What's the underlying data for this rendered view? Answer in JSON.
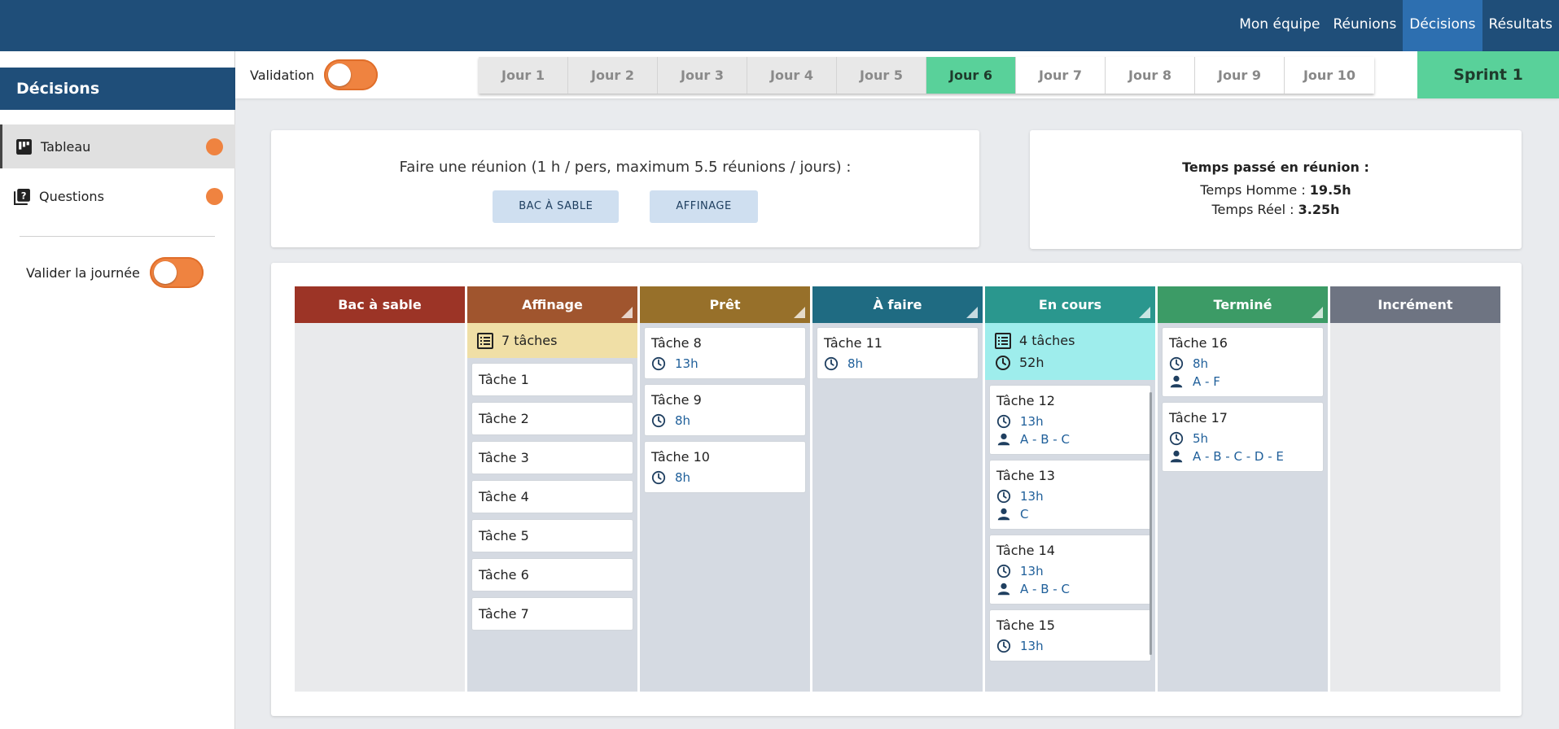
{
  "topnav": [
    "Mon équipe",
    "Réunions",
    "Décisions",
    "Résultats"
  ],
  "sidebar": {
    "title": "Décisions",
    "items": [
      {
        "label": "Tableau",
        "icon": "board-icon"
      },
      {
        "label": "Questions",
        "icon": "question-icon"
      }
    ],
    "validate_day": "Valider la journée"
  },
  "daybar": {
    "validation_label": "Validation",
    "days": [
      "Jour 1",
      "Jour 2",
      "Jour 3",
      "Jour 4",
      "Jour 5",
      "Jour 6",
      "Jour 7",
      "Jour 8",
      "Jour 9",
      "Jour 10"
    ],
    "current_day": "Jour 6",
    "sprint": "Sprint 1"
  },
  "meeting": {
    "title": "Faire une réunion (1 h / pers, maximum 5.5 réunions / jours) :",
    "buttons": [
      "BAC À SABLE",
      "AFFINAGE"
    ]
  },
  "time_spent": {
    "title": "Temps passé en réunion :",
    "homme_label": "Temps Homme : ",
    "homme_value": "19.5h",
    "reel_label": "Temps Réel : ",
    "reel_value": "3.25h"
  },
  "colors": {
    "accent_orange": "#ef8340",
    "navy": "#1f4e79",
    "green": "#59d19a"
  },
  "board": {
    "columns": [
      {
        "title": "Bac à sable",
        "color": "#9c3426"
      },
      {
        "title": "Affinage",
        "color": "#a0552e",
        "summary_count": "7 tâches",
        "summary_bg": "#f0dfa6",
        "tasks": [
          {
            "name": "Tâche 1"
          },
          {
            "name": "Tâche 2"
          },
          {
            "name": "Tâche 3"
          },
          {
            "name": "Tâche 4"
          },
          {
            "name": "Tâche 5"
          },
          {
            "name": "Tâche 6"
          },
          {
            "name": "Tâche 7"
          }
        ]
      },
      {
        "title": "Prêt",
        "color": "#97702a",
        "tasks": [
          {
            "name": "Tâche 8",
            "time": "13h"
          },
          {
            "name": "Tâche 9",
            "time": "8h"
          },
          {
            "name": "Tâche 10",
            "time": "8h"
          }
        ]
      },
      {
        "title": "À faire",
        "color": "#1f6b82",
        "tasks": [
          {
            "name": "Tâche 11",
            "time": "8h"
          }
        ]
      },
      {
        "title": "En cours",
        "color": "#2a978e",
        "summary_count": "4 tâches",
        "summary_time": "52h",
        "summary_bg": "#9eedec",
        "tasks": [
          {
            "name": "Tâche 12",
            "time": "13h",
            "people": "A - B - C"
          },
          {
            "name": "Tâche 13",
            "time": "13h",
            "people": "C"
          },
          {
            "name": "Tâche 14",
            "time": "13h",
            "people": "A - B - C"
          },
          {
            "name": "Tâche 15",
            "time": "13h",
            "people": ""
          }
        ]
      },
      {
        "title": "Terminé",
        "color": "#3c9b66",
        "tasks": [
          {
            "name": "Tâche 16",
            "time": "8h",
            "people": "A - F"
          },
          {
            "name": "Tâche 17",
            "time": "5h",
            "people": "A - B - C - D - E"
          }
        ]
      },
      {
        "title": "Incrément",
        "color": "#6e7482"
      }
    ]
  }
}
